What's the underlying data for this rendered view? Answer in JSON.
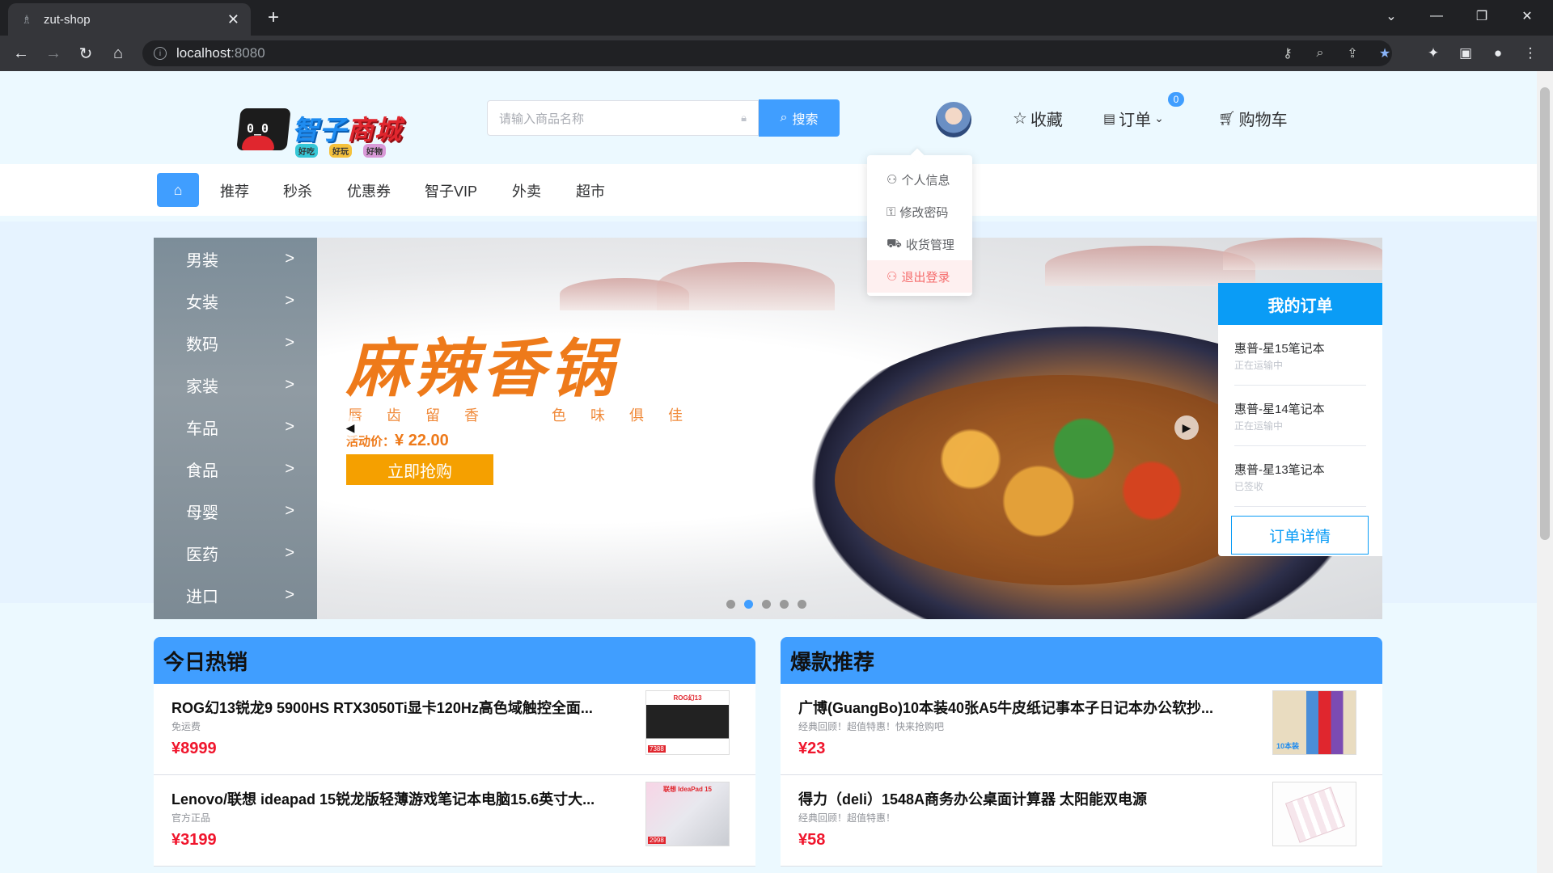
{
  "browser": {
    "tab_title": "zut-shop",
    "url_host": "localhost",
    "url_port": ":8080"
  },
  "header": {
    "logo_text_blue": "智子",
    "logo_text_red": "商城",
    "logo_tags": [
      "好吃",
      "好玩",
      "好物"
    ],
    "search_placeholder": "请输入商品名称",
    "search_button": "搜索",
    "favorites": "收藏",
    "orders": "订单",
    "orders_badge": "0",
    "cart": "购物车"
  },
  "nav": {
    "items": [
      "推荐",
      "秒杀",
      "优惠券",
      "智子VIP",
      "外卖",
      "超市"
    ]
  },
  "user_menu": {
    "items": [
      "个人信息",
      "修改密码",
      "收货管理",
      "退出登录"
    ]
  },
  "categories": [
    "男装",
    "女装",
    "数码",
    "家装",
    "车品",
    "食品",
    "母婴",
    "医药",
    "进口"
  ],
  "category_arrow": ">",
  "banner": {
    "title": "麻辣香锅",
    "subtitle_left": "唇齿留香",
    "subtitle_right": "色味俱佳",
    "price_label": "活动价：",
    "price": "¥ 22.00",
    "cta": "立即抢购",
    "slide_count": 5,
    "active_slide": 2
  },
  "my_orders": {
    "title": "我的订单",
    "items": [
      {
        "name": "惠普-星15笔记本",
        "status": "正在运输中"
      },
      {
        "name": "惠普-星14笔记本",
        "status": "正在运输中"
      },
      {
        "name": "惠普-星13笔记本",
        "status": "已签收"
      }
    ],
    "detail_button": "订单详情"
  },
  "hot_today": {
    "title": "今日热销",
    "products": [
      {
        "name": "ROG幻13锐龙9 5900HS RTX3050Ti显卡120Hz高色域触控全面...",
        "desc": "免运费",
        "price": "¥8999",
        "thumb_label": "ROG幻13",
        "thumb_price": "7388"
      },
      {
        "name": "Lenovo/联想 ideapad 15锐龙版轻薄游戏笔记本电脑15.6英寸大...",
        "desc": "官方正品",
        "price": "¥3199",
        "thumb_label": "联想 IdeaPad 15",
        "thumb_price": "2998"
      }
    ]
  },
  "recommend": {
    "title": "爆款推荐",
    "products": [
      {
        "name": "广博(GuangBo)10本装40张A5牛皮纸记事本子日记本办公软抄...",
        "desc": "经典回顾！超值特惠！快来抢购吧",
        "price": "¥23",
        "thumb_label": "10本装"
      },
      {
        "name": "得力（deli）1548A商务办公桌面计算器 太阳能双电源",
        "desc": "经典回顾！超值特惠！",
        "price": "¥58",
        "thumb_label": ""
      }
    ]
  },
  "colors": {
    "primary": "#409eff",
    "price_red": "#f0162d",
    "orders_header": "#0a9cf6",
    "promo_orange": "#ee7a1a"
  }
}
